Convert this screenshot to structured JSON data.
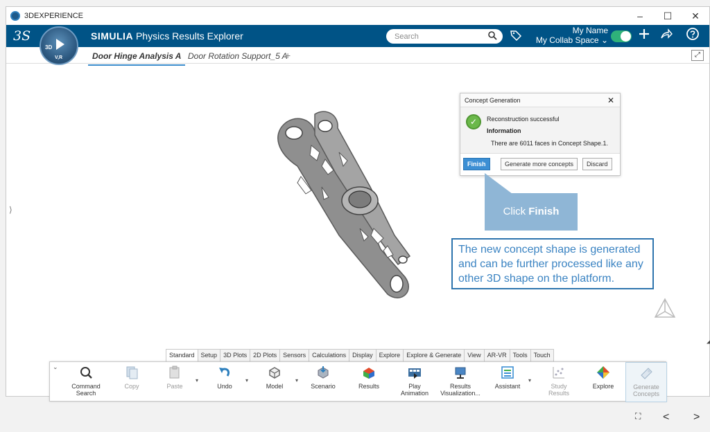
{
  "window": {
    "title": "3DEXPERIENCE",
    "controls": [
      "–",
      "☐",
      "✕"
    ]
  },
  "app": {
    "brand_logo": "3S",
    "compass": {
      "label_left": "3D",
      "label_bottom": "V,R"
    },
    "brand_prefix": "SIMULIA",
    "app_name": "Physics Results Explorer",
    "search_placeholder": "Search",
    "user_name": "My Name",
    "collab_space": "My Collab Space",
    "collab_chevron": "⌄",
    "icons": {
      "search": "search-icon",
      "tag": "tag-icon",
      "plus": "plus-icon",
      "share": "share-icon",
      "help": "help-icon"
    },
    "accent_color": "#005386"
  },
  "tabs": [
    {
      "label": "Door Hinge Analysis A",
      "active": true
    },
    {
      "label": "Door Rotation Support_5 A",
      "active": false
    }
  ],
  "tab_add": "+",
  "dialog": {
    "title": "Concept Generation",
    "close": "✕",
    "status": "Reconstruction successful",
    "info_title": "Information",
    "info_text": "There are 6011 faces in Concept Shape.1.",
    "buttons": {
      "finish": "Finish",
      "generate_more": "Generate more concepts",
      "discard": "Discard"
    }
  },
  "callout": {
    "prefix": "Click ",
    "strong": "Finish"
  },
  "info_box": "The new concept shape is generated and can be further processed like any other 3D shape on the platform.",
  "toolbar_tabs": [
    {
      "label": "Standard",
      "active": true
    },
    {
      "label": "Setup"
    },
    {
      "label": "3D Plots"
    },
    {
      "label": "2D Plots"
    },
    {
      "label": "Sensors"
    },
    {
      "label": "Calculations"
    },
    {
      "label": "Display"
    },
    {
      "label": "Explore"
    },
    {
      "label": "Explore & Generate"
    },
    {
      "label": "View"
    },
    {
      "label": "AR-VR"
    },
    {
      "label": "Tools"
    },
    {
      "label": "Touch"
    }
  ],
  "tools": [
    {
      "label1": "Command",
      "label2": "Search",
      "icon": "command-search-icon",
      "disabled": false
    },
    {
      "label1": "Copy",
      "label2": "",
      "icon": "copy-icon",
      "disabled": true
    },
    {
      "label1": "Paste",
      "label2": "",
      "icon": "paste-icon",
      "disabled": true
    },
    {
      "label1": "Undo",
      "label2": "",
      "icon": "undo-icon",
      "disabled": false
    },
    {
      "label1": "Model",
      "label2": "",
      "icon": "model-icon",
      "disabled": false
    },
    {
      "label1": "Scenario",
      "label2": "",
      "icon": "scenario-icon",
      "disabled": false
    },
    {
      "label1": "Results",
      "label2": "",
      "icon": "results-icon",
      "disabled": false
    },
    {
      "label1": "Play",
      "label2": "Animation",
      "icon": "play-animation-icon",
      "disabled": false
    },
    {
      "label1": "Results",
      "label2": "Visualization...",
      "icon": "results-visualization-icon",
      "disabled": false
    },
    {
      "label1": "Assistant",
      "label2": "",
      "icon": "assistant-icon",
      "disabled": false
    },
    {
      "label1": "Study",
      "label2": "Results",
      "icon": "study-results-icon",
      "disabled": true
    },
    {
      "label1": "Explore",
      "label2": "",
      "icon": "explore-icon",
      "disabled": false
    },
    {
      "label1": "Generate",
      "label2": "Concepts",
      "icon": "generate-concepts-icon",
      "disabled": true
    }
  ],
  "footer": {
    "fullscreen": "⛶",
    "prev": "<",
    "next": ">"
  }
}
